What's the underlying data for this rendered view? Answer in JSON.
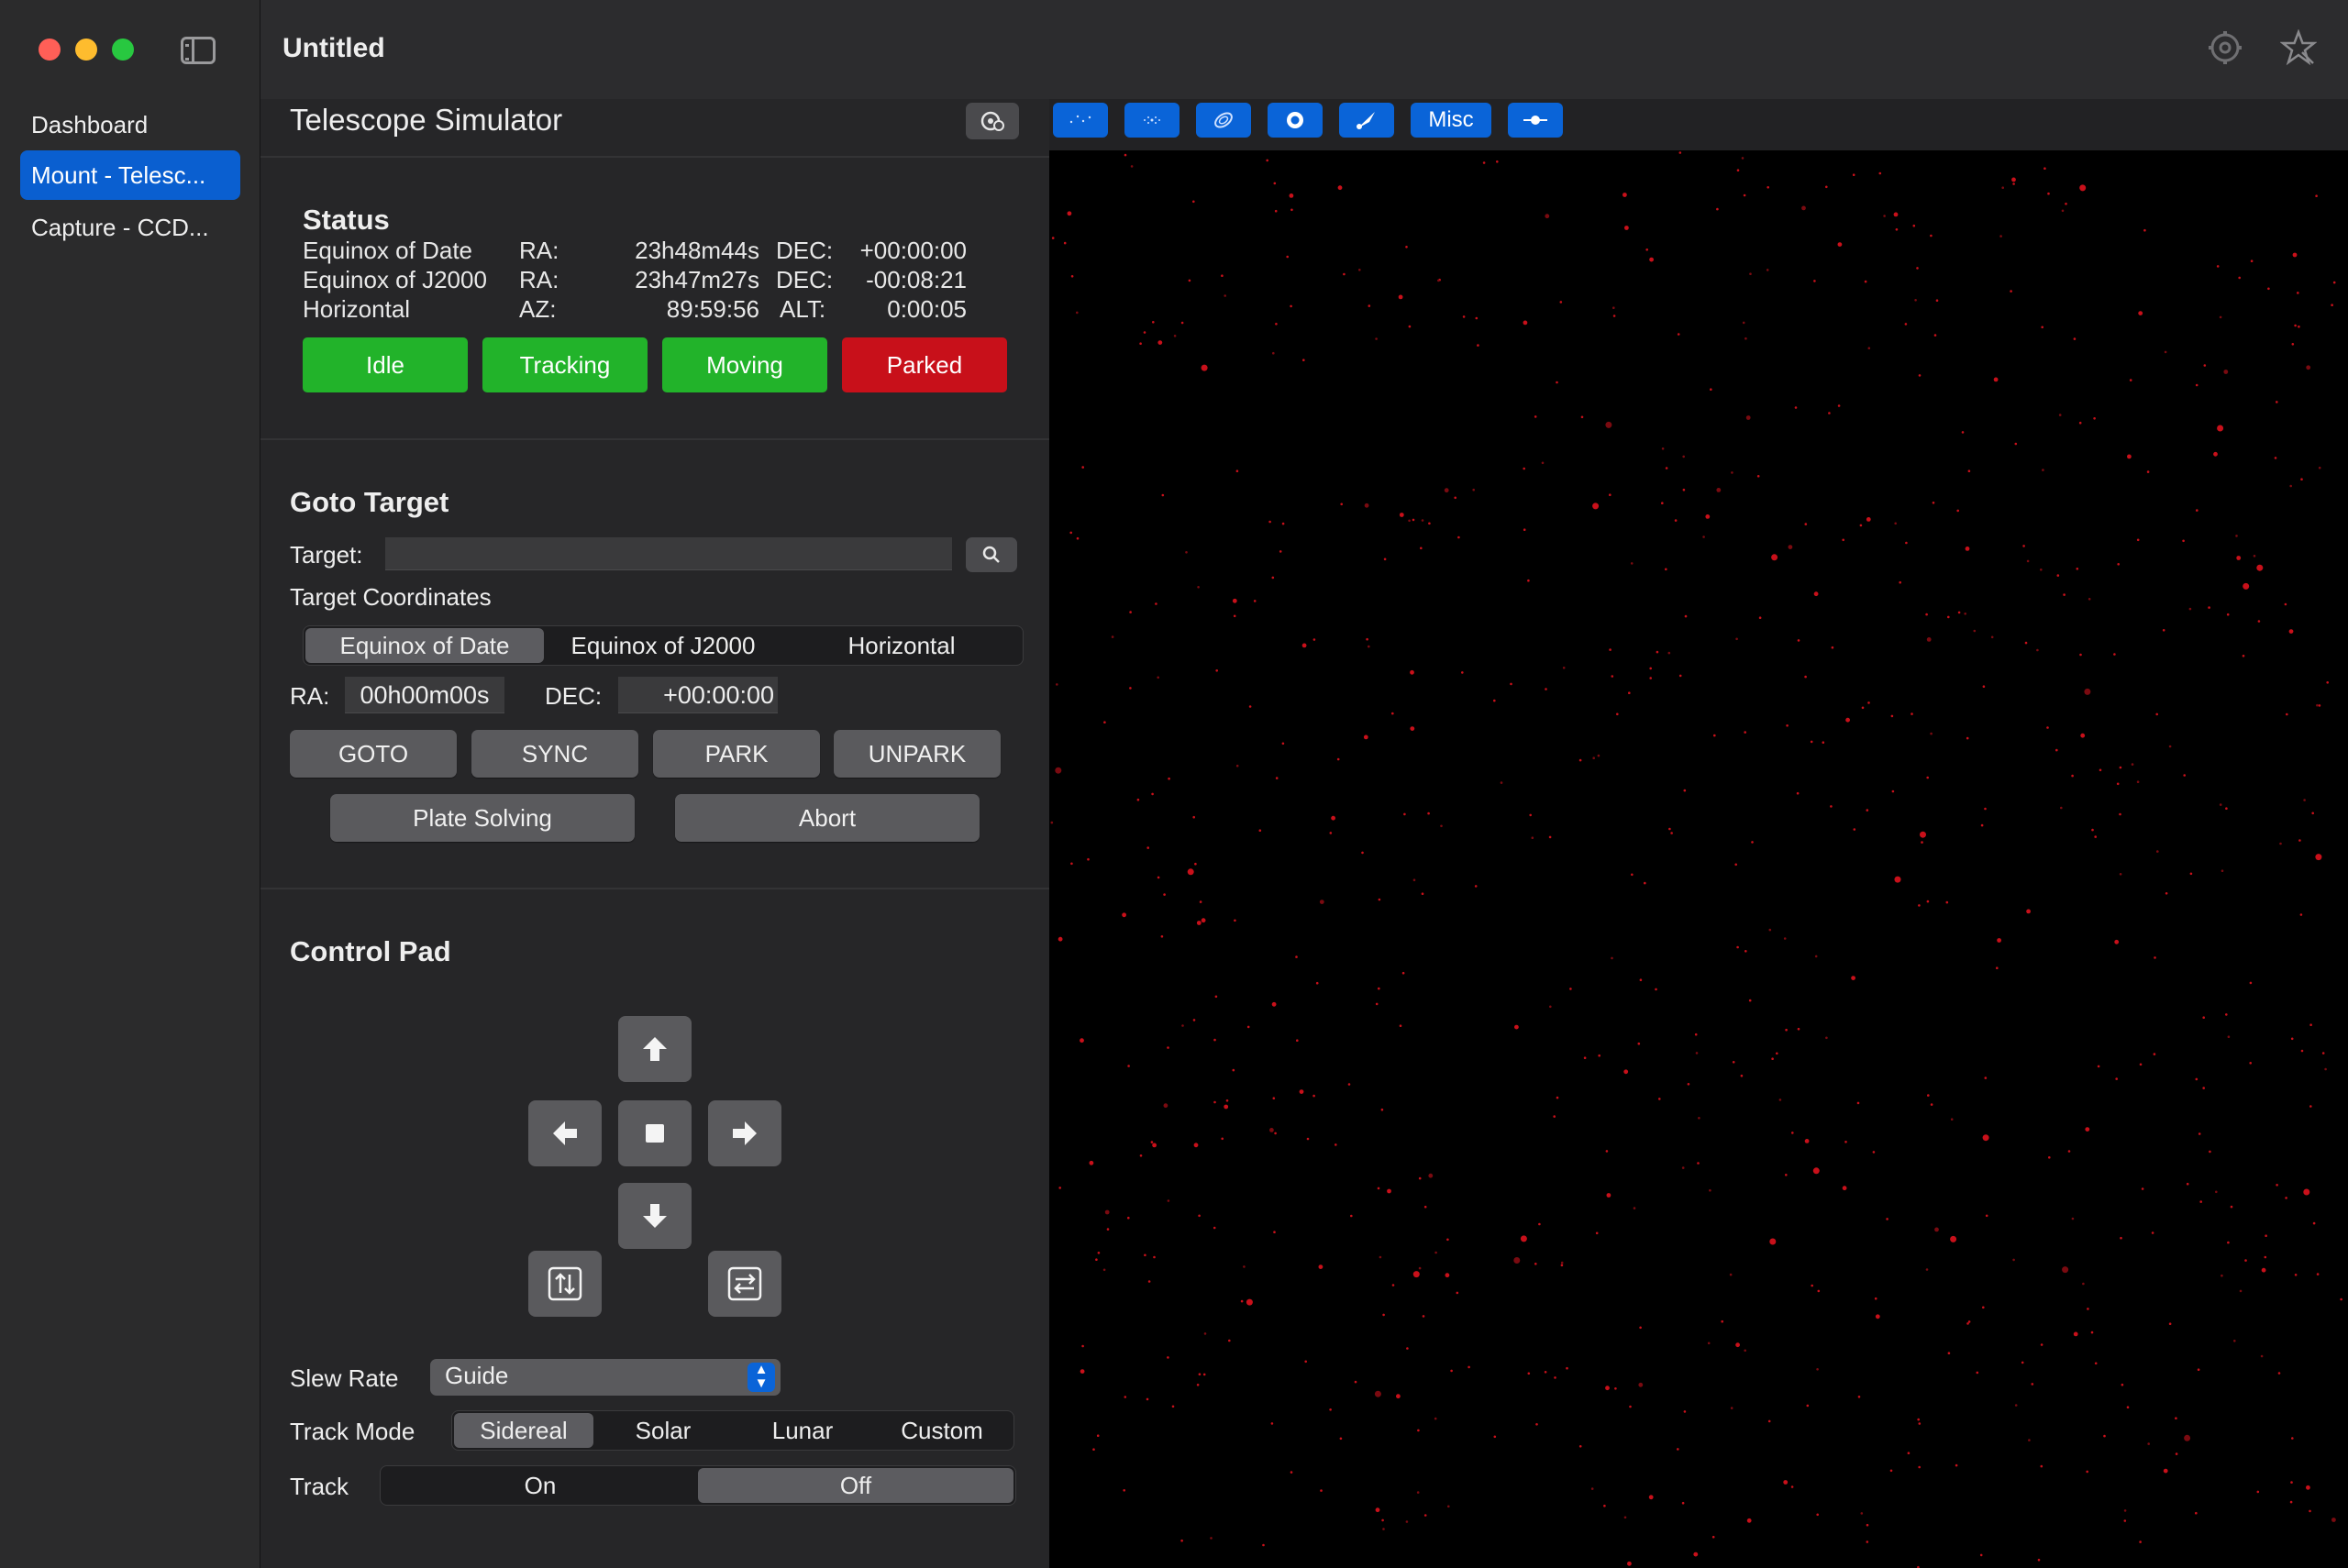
{
  "window": {
    "title": "Untitled"
  },
  "colors": {
    "accent": "#0a64d8",
    "ok": "#22b32a",
    "alert": "#c8101a",
    "star": "#c8101a"
  },
  "sidebar": {
    "items": [
      {
        "label": "Dashboard",
        "active": false
      },
      {
        "label": "Mount - Telesc...",
        "active": true
      },
      {
        "label": "Capture - CCD...",
        "active": false
      }
    ]
  },
  "panel": {
    "title": "Telescope Simulator",
    "status": {
      "title": "Status",
      "rows": [
        {
          "name": "Equinox of Date",
          "a_label": "RA:",
          "a_value": "23h48m44s",
          "b_label": "DEC:",
          "b_value": "+00:00:00"
        },
        {
          "name": "Equinox of J2000",
          "a_label": "RA:",
          "a_value": "23h47m27s",
          "b_label": "DEC:",
          "b_value": "-00:08:21"
        },
        {
          "name": "Horizontal",
          "a_label": "AZ:",
          "a_value": "89:59:56",
          "b_label": "ALT:",
          "b_value": "0:00:05"
        }
      ],
      "states": [
        "Idle",
        "Tracking",
        "Moving",
        "Parked"
      ]
    },
    "goto": {
      "title": "Goto Target",
      "target_label": "Target:",
      "target_value": "",
      "coords_label": "Target Coordinates",
      "coord_tabs": [
        "Equinox of Date",
        "Equinox of J2000",
        "Horizontal"
      ],
      "ra_label": "RA:",
      "ra_value": "00h00m00s",
      "dec_label": "DEC:",
      "dec_value": "+00:00:00",
      "buttons": [
        "GOTO",
        "SYNC",
        "PARK",
        "UNPARK"
      ],
      "plate_solving": "Plate Solving",
      "abort": "Abort"
    },
    "control": {
      "title": "Control Pad",
      "slew_label": "Slew Rate",
      "slew_value": "Guide",
      "track_mode_label": "Track Mode",
      "track_modes": [
        "Sidereal",
        "Solar",
        "Lunar",
        "Custom"
      ],
      "track_label": "Track",
      "track_options": [
        "On",
        "Off"
      ]
    }
  },
  "sky_toolbar": {
    "misc_label": "Misc"
  }
}
